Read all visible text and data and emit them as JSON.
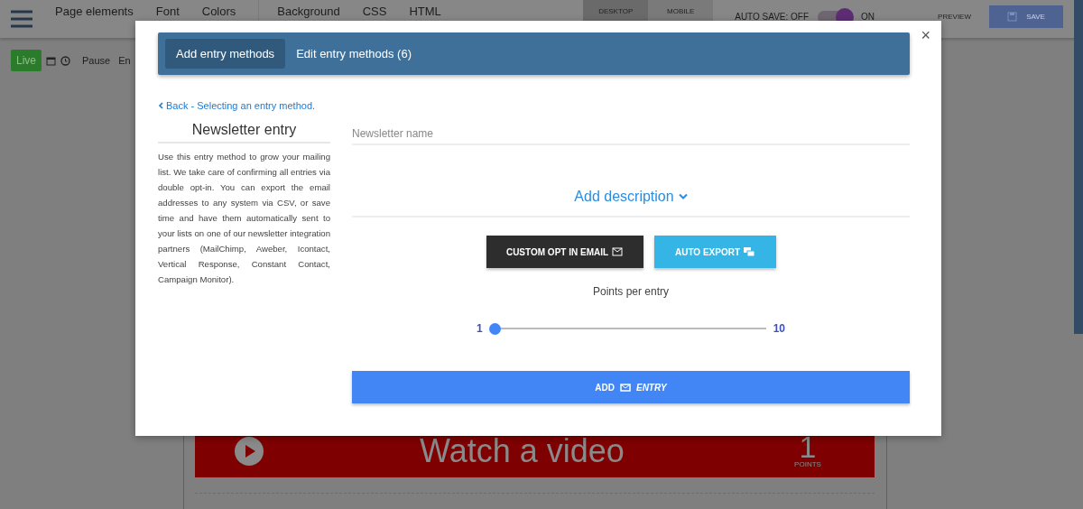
{
  "top_bar": {
    "menu_items": [
      "Page elements",
      "Font",
      "Colors"
    ],
    "code_items": [
      "Background",
      "CSS",
      "HTML"
    ],
    "view_tabs": [
      {
        "label": "DESKTOP",
        "selected": true
      },
      {
        "label": "MOBILE",
        "selected": false
      }
    ],
    "auto_save": {
      "label_off": "AUTO SAVE: OFF",
      "label_on": "ON",
      "on": true
    },
    "preview": "PREVIEW",
    "save": "SAVE"
  },
  "toolbar": {
    "live": "Live",
    "pause": "Pause",
    "partial": "En"
  },
  "canvas": {
    "video_entry": {
      "title": "Watch a video",
      "points": "1",
      "points_label": "POINTS"
    }
  },
  "modal": {
    "close": "×",
    "tabs": [
      {
        "label": "Add entry methods",
        "selected": true
      },
      {
        "label": "Edit entry methods (6)",
        "selected": false
      }
    ],
    "back_link": "Back - Selecting an entry method.",
    "title": "Newsletter entry",
    "description": "Use this entry method to grow your mailing list. We take care of confirming all entries via double opt-in. You can export the email addresses to any system via CSV, or save time and have them automatically sent to your lists on one of our newsletter integration partners (MailChimp, Aweber, Icontact, Vertical Response, Constant Contact, Campaign Monitor).",
    "name_field": {
      "placeholder": "Newsletter name"
    },
    "add_description": "Add description",
    "buttons": [
      {
        "label": "CUSTOM OPT IN EMAIL",
        "kind": "dark"
      },
      {
        "label": "AUTO EXPORT",
        "kind": "light"
      }
    ],
    "points": {
      "label": "Points per entry",
      "min": "1",
      "max": "10",
      "level": 0
    },
    "add_button": {
      "label": "ADD",
      "label_italic": "ENTRY"
    }
  }
}
